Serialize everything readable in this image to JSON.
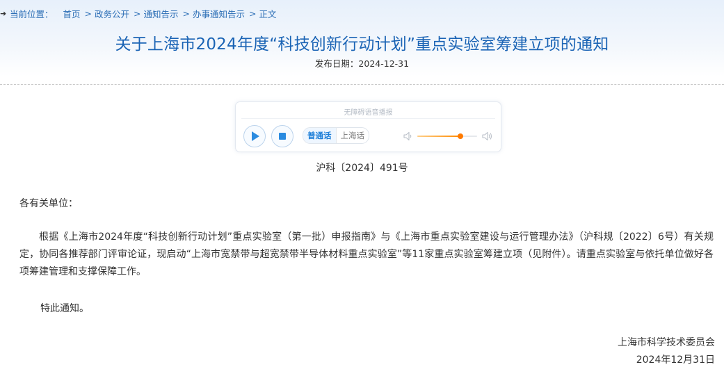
{
  "breadcrumb": {
    "label": "当前位置：",
    "items": [
      "首页",
      "政务公开",
      "通知告示",
      "办事通知告示",
      "正文"
    ]
  },
  "article": {
    "title": "关于上海市2024年度“科技创新行动计划”重点实验室筹建立项的通知",
    "publish_date": "发布日期：2024-12-31",
    "doc_number": "沪科〔2024〕491号",
    "salutation": "各有关单位：",
    "body": "根据《上海市2024年度“科技创新行动计划”重点实验室（第一批）申报指南》与《上海市重点实验室建设与运行管理办法》（沪科规〔2022〕6号）有关规定，协同各推荐部门评审论证，现启动“上海市宽禁带与超宽禁带半导体材料重点实验室”等11家重点实验室筹建立项（见附件）。请重点实验室与依托单位做好各项筹建管理和支撑保障工作。",
    "closing": "特此通知。",
    "signature_org": "上海市科学技术委员会",
    "signature_date": "2024年12月31日"
  },
  "player": {
    "title": "无障碍语音播报",
    "lang_mandarin": "普通话",
    "lang_shanghainese": "上海话",
    "volume_level": 0.72,
    "accent_color": "#ff7a00",
    "button_color": "#2a8be0",
    "icons": [
      "play-icon",
      "stop-icon",
      "volume-low-icon",
      "volume-high-icon"
    ]
  },
  "colors": {
    "title": "#1b64b5",
    "link": "#2a6db5"
  }
}
